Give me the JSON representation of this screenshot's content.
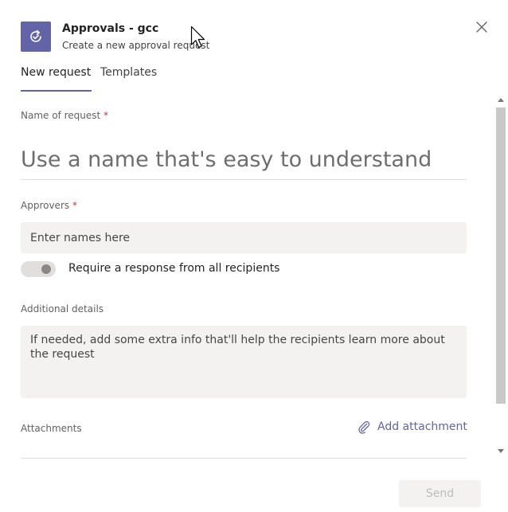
{
  "header": {
    "title": "Approvals - gcc",
    "subtitle": "Create a new approval request"
  },
  "tabs": [
    {
      "label": "New request",
      "active": true
    },
    {
      "label": "Templates",
      "active": false
    }
  ],
  "form": {
    "name": {
      "label": "Name of request",
      "required_mark": "*",
      "value": "",
      "placeholder": "Use a name that's easy to understand"
    },
    "approvers": {
      "label": "Approvers",
      "required_mark": "*",
      "value": "",
      "placeholder": "Enter names here"
    },
    "require_all": {
      "label": "Require a response from all recipients",
      "checked": false
    },
    "details": {
      "label": "Additional details",
      "value": "",
      "placeholder": "If needed, add some extra info that'll help the recipients learn more about the request"
    },
    "attachments": {
      "label": "Attachments",
      "add_label": "Add attachment"
    }
  },
  "footer": {
    "send_label": "Send",
    "send_disabled": true
  },
  "colors": {
    "brand": "#6264a7",
    "required": "#c4314b",
    "input_bg": "#f3f2f1"
  },
  "icons": {
    "app": "approvals-icon",
    "close": "close-icon",
    "attach": "paperclip-icon"
  }
}
